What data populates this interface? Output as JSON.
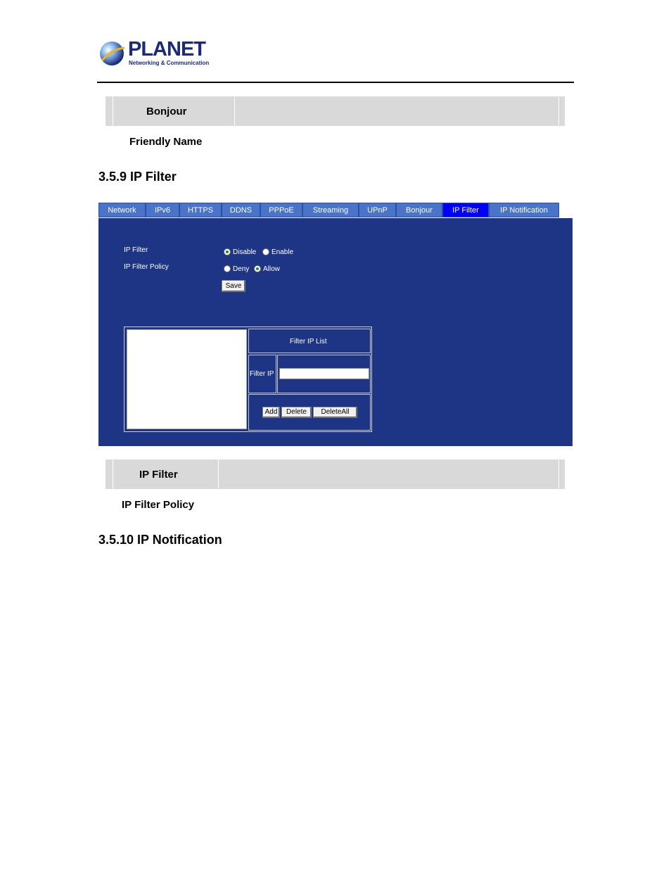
{
  "logo": {
    "name": "PLANET",
    "tagline": "Networking & Communication"
  },
  "bonjour_row": {
    "label": "Bonjour"
  },
  "bonjour_desc": {
    "friendly_name": "Friendly Name"
  },
  "section_ip_filter": {
    "title": "3.5.9 IP Filter"
  },
  "tabs": [
    {
      "label": "Network"
    },
    {
      "label": "IPv6"
    },
    {
      "label": "HTTPS"
    },
    {
      "label": "DDNS"
    },
    {
      "label": "PPPoE"
    },
    {
      "label": "Streaming"
    },
    {
      "label": "UPnP"
    },
    {
      "label": "Bonjour"
    },
    {
      "label": "IP Filter",
      "active": true
    },
    {
      "label": "IP Notification"
    }
  ],
  "panel": {
    "ip_filter_label": "IP Filter",
    "ip_filter_disable": "Disable",
    "ip_filter_enable": "Enable",
    "ip_filter_selected": "Disable",
    "policy_label": "IP Filter Policy",
    "policy_deny": "Deny",
    "policy_allow": "Allow",
    "policy_selected": "Allow",
    "save_label": "Save",
    "filter_list_title": "Filter IP List",
    "filter_ip_label": "Filter IP",
    "filter_ip_value": "",
    "add_label": "Add",
    "delete_label": "Delete",
    "delete_all_label": "DeleteAll"
  },
  "ipfilter_row": {
    "label": "IP Filter"
  },
  "ipfilter_desc": {
    "policy": "IP Filter Policy"
  },
  "section_ip_notification": {
    "title": "3.5.10 IP Notification"
  },
  "colors": {
    "panel_bg": "#1d3584",
    "tab_bg": "#4a74c9",
    "tab_active": "#0000ff",
    "row_gray": "#d9d9d9"
  }
}
